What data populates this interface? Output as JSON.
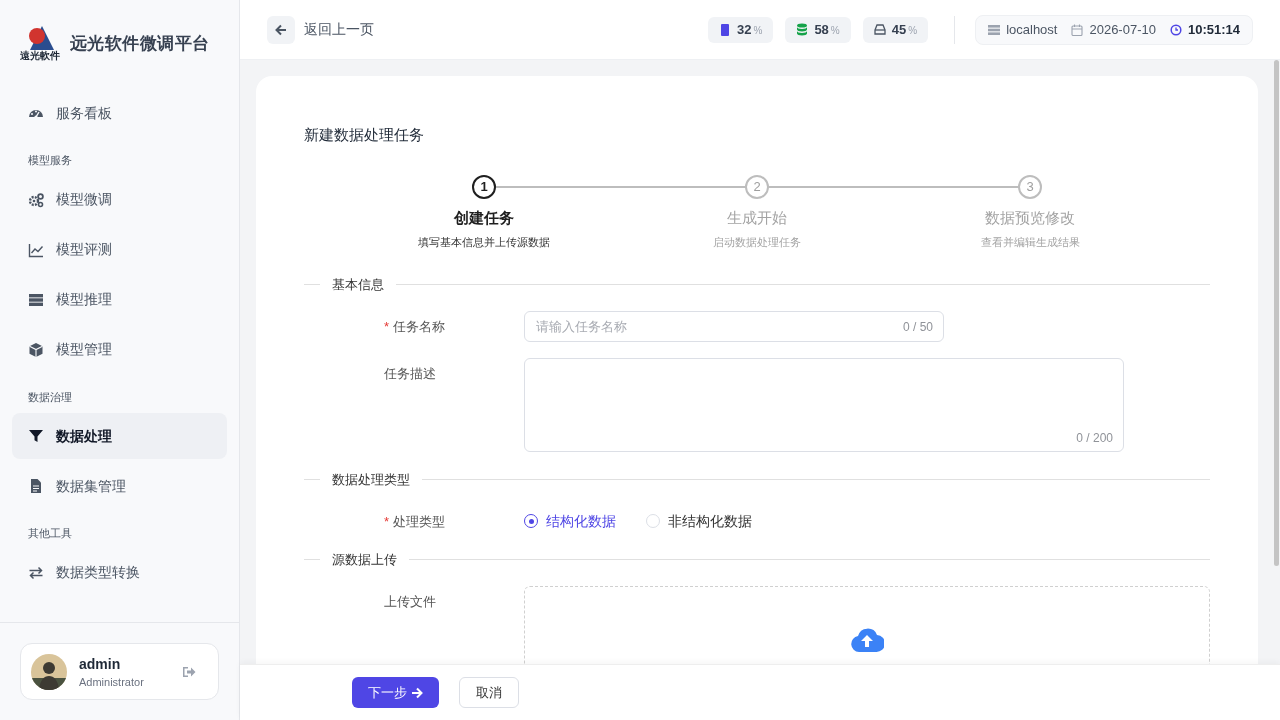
{
  "sidebar": {
    "brand": "远光软件微调平台",
    "logo_caption": "遠光軟件",
    "nav": [
      {
        "kind": "item",
        "label": "服务看板",
        "selected": false
      },
      {
        "kind": "group",
        "label": "模型服务"
      },
      {
        "kind": "item",
        "label": "模型微调",
        "selected": false
      },
      {
        "kind": "item",
        "label": "模型评测",
        "selected": false
      },
      {
        "kind": "item",
        "label": "模型推理",
        "selected": false
      },
      {
        "kind": "item",
        "label": "模型管理",
        "selected": false
      },
      {
        "kind": "group",
        "label": "数据治理"
      },
      {
        "kind": "item",
        "label": "数据处理",
        "selected": true
      },
      {
        "kind": "item",
        "label": "数据集管理",
        "selected": false
      },
      {
        "kind": "group",
        "label": "其他工具"
      },
      {
        "kind": "item",
        "label": "数据类型转换",
        "selected": false
      }
    ],
    "user": {
      "name": "admin",
      "role": "Administrator"
    }
  },
  "header": {
    "back_label": "返回上一页",
    "stats": [
      {
        "value": "32",
        "unit": "%"
      },
      {
        "value": "58",
        "unit": "%"
      },
      {
        "value": "45",
        "unit": "%"
      }
    ],
    "host": "localhost",
    "date": "2026-07-10",
    "time": "10:51:14"
  },
  "form": {
    "title": "新建数据处理任务",
    "steps": [
      {
        "number": "1",
        "title": "创建任务",
        "subtitle": "填写基本信息并上传源数据",
        "selected": true
      },
      {
        "number": "2",
        "title": "生成开始",
        "subtitle": "启动数据处理任务",
        "selected": false
      },
      {
        "number": "3",
        "title": "数据预览修改",
        "subtitle": "查看并编辑生成结果",
        "selected": false
      }
    ],
    "sections": [
      {
        "title": "基本信息",
        "fields": [
          {
            "kind": "input",
            "label": "任务名称",
            "required_mark": "*",
            "placeholder": "请输入任务名称",
            "count": "0 / 50"
          },
          {
            "kind": "textarea",
            "label": "任务描述",
            "count": "0 / 200"
          }
        ]
      },
      {
        "title": "数据处理类型",
        "fields": [
          {
            "kind": "radio",
            "label": "处理类型",
            "required_mark": "*",
            "options": [
              {
                "label": "结构化数据",
                "selected": true
              },
              {
                "label": "非结构化数据",
                "selected": false
              }
            ]
          }
        ]
      },
      {
        "title": "源数据上传",
        "fields": [
          {
            "kind": "upload",
            "label": "上传文件"
          }
        ]
      }
    ]
  },
  "footer": {
    "next": "下一步",
    "cancel": "取消"
  }
}
